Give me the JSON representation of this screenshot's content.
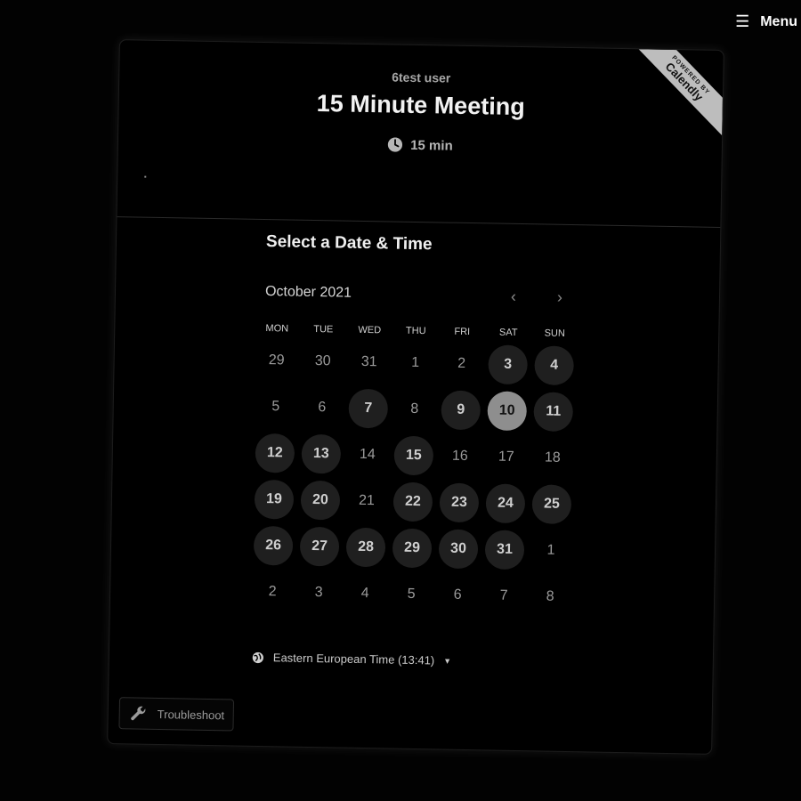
{
  "top_menu": {
    "label": "Menu"
  },
  "ribbon": {
    "small": "POWERED BY",
    "brand": "Calendly"
  },
  "header": {
    "owner": "6test user",
    "title": "15 Minute Meeting",
    "duration": "15 min"
  },
  "main": {
    "title": "Select a Date & Time",
    "month": "October 2021",
    "prev": "‹",
    "next": "›"
  },
  "weekdays": [
    "MON",
    "TUE",
    "WED",
    "THU",
    "FRI",
    "SAT",
    "SUN"
  ],
  "weeks": [
    [
      {
        "d": "29",
        "s": "muted"
      },
      {
        "d": "30",
        "s": "muted"
      },
      {
        "d": "31",
        "s": "muted"
      },
      {
        "d": "1",
        "s": "muted"
      },
      {
        "d": "2",
        "s": "muted"
      },
      {
        "d": "3",
        "s": "avail"
      },
      {
        "d": "4",
        "s": "avail"
      }
    ],
    [
      {
        "d": "5",
        "s": "muted"
      },
      {
        "d": "6",
        "s": "muted"
      },
      {
        "d": "7",
        "s": "avail"
      },
      {
        "d": "8",
        "s": "muted"
      },
      {
        "d": "9",
        "s": "avail"
      },
      {
        "d": "10",
        "s": "selected"
      },
      {
        "d": "11",
        "s": "avail"
      }
    ],
    [
      {
        "d": "12",
        "s": "avail"
      },
      {
        "d": "13",
        "s": "avail"
      },
      {
        "d": "14",
        "s": "muted"
      },
      {
        "d": "15",
        "s": "avail"
      },
      {
        "d": "16",
        "s": "muted"
      },
      {
        "d": "17",
        "s": "muted"
      },
      {
        "d": "18",
        "s": "muted"
      }
    ],
    [
      {
        "d": "19",
        "s": "avail"
      },
      {
        "d": "20",
        "s": "avail"
      },
      {
        "d": "21",
        "s": "muted"
      },
      {
        "d": "22",
        "s": "avail"
      },
      {
        "d": "23",
        "s": "avail"
      },
      {
        "d": "24",
        "s": "avail"
      },
      {
        "d": "25",
        "s": "avail"
      }
    ],
    [
      {
        "d": "26",
        "s": "avail"
      },
      {
        "d": "27",
        "s": "avail"
      },
      {
        "d": "28",
        "s": "avail"
      },
      {
        "d": "29",
        "s": "avail"
      },
      {
        "d": "30",
        "s": "avail"
      },
      {
        "d": "31",
        "s": "avail"
      },
      {
        "d": "1",
        "s": "muted"
      }
    ],
    [
      {
        "d": "2",
        "s": "muted"
      },
      {
        "d": "3",
        "s": "muted"
      },
      {
        "d": "4",
        "s": "muted"
      },
      {
        "d": "5",
        "s": "muted"
      },
      {
        "d": "6",
        "s": "muted"
      },
      {
        "d": "7",
        "s": "muted"
      },
      {
        "d": "8",
        "s": "muted"
      }
    ]
  ],
  "timezone": {
    "label": "Eastern European Time (13:41)"
  },
  "troubleshoot": {
    "label": "Troubleshoot"
  },
  "colors": {
    "background": "#000000",
    "available_day": "#1f1f1f",
    "selected_day": "#8e8e8e"
  },
  "icons": {
    "menu": "hamburger-icon",
    "clock": "clock-icon",
    "globe": "globe-icon",
    "troubleshoot": "wrench-icon"
  }
}
